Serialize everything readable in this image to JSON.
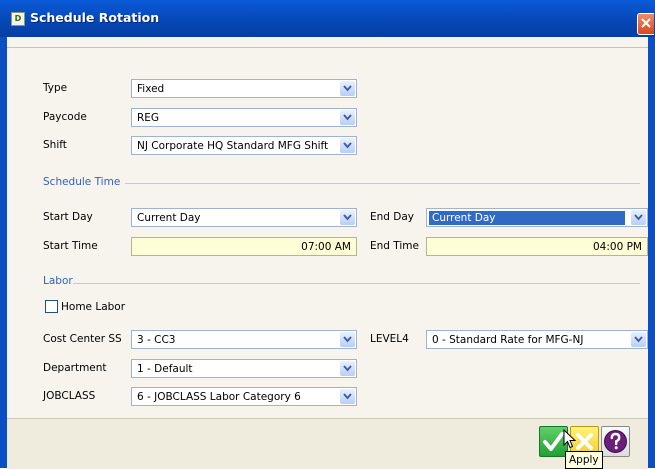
{
  "window": {
    "title": "Schedule Rotation",
    "logo_text": "D",
    "close_icon": "close-x-icon"
  },
  "general": {
    "type_label": "Type",
    "type_value": "Fixed",
    "paycode_label": "Paycode",
    "paycode_value": "REG",
    "shift_label": "Shift",
    "shift_value": "NJ Corporate HQ Standard MFG Shift"
  },
  "schedule_time": {
    "section_label": "Schedule Time",
    "start_day_label": "Start Day",
    "start_day_value": "Current Day",
    "end_day_label": "End Day",
    "end_day_value": "Current Day",
    "start_time_label": "Start Time",
    "start_time_value": "07:00 AM",
    "end_time_label": "End Time",
    "end_time_value": "04:00 PM"
  },
  "labor": {
    "section_label": "Labor",
    "home_labor_label": "Home Labor",
    "home_labor_checked": false,
    "cost_center_label": "Cost Center SS",
    "cost_center_value": "3 - CC3",
    "level4_label": "LEVEL4",
    "level4_value": "0 - Standard Rate for MFG-NJ",
    "department_label": "Department",
    "department_value": "1 - Default",
    "jobclass_label": "JOBCLASS",
    "jobclass_value": "6 - JOBCLASS Labor Category 6"
  },
  "footer": {
    "apply_icon": "checkmark-icon",
    "cancel_icon": "x-icon",
    "help_icon": "question-mark-icon",
    "tooltip": "Apply"
  },
  "colors": {
    "title_bar": "#0648b8",
    "section_label": "#2f62c4",
    "time_field_bg": "#fefdd6",
    "selection": "#316ac5",
    "apply_button": "#23a033",
    "cancel_button": "#f2cf2a"
  }
}
